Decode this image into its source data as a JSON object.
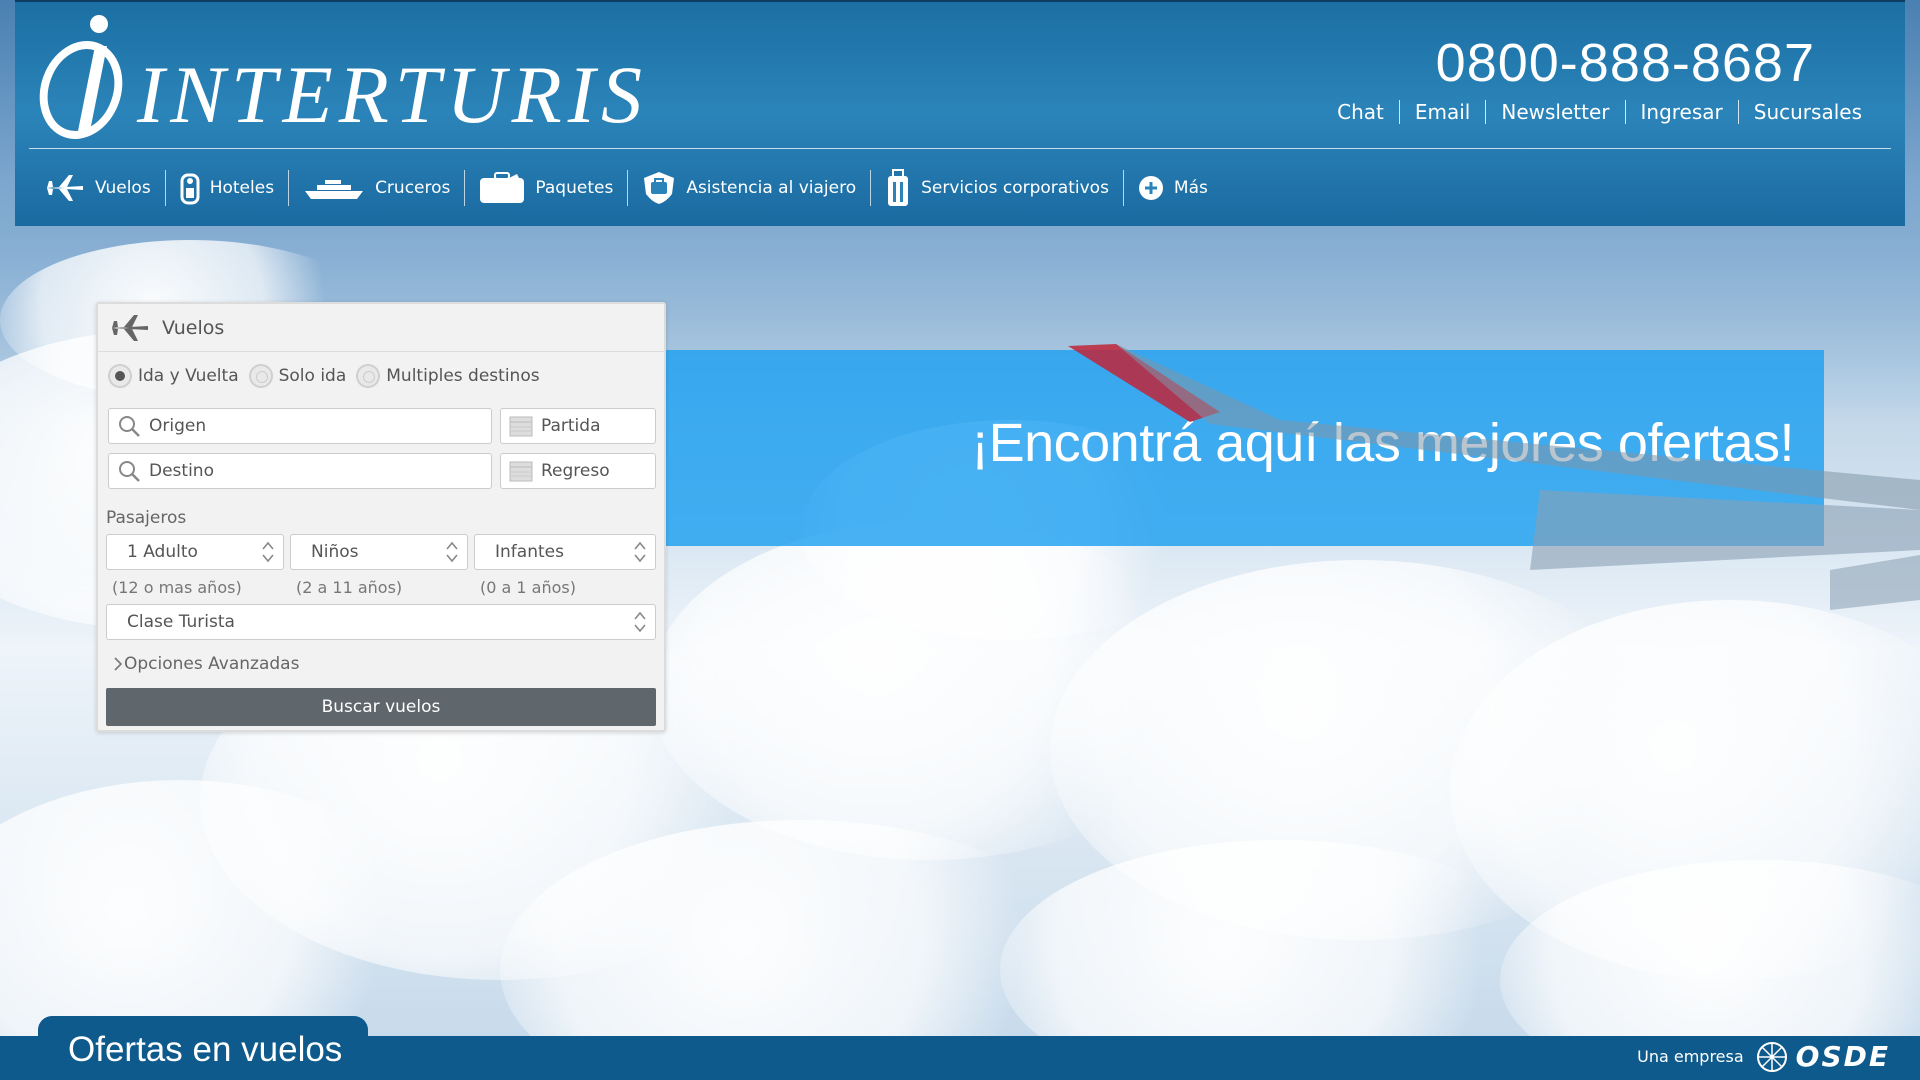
{
  "brand": {
    "name": "INTERTURIS",
    "logo_letter": "i"
  },
  "header": {
    "phone": "0800-888-8687",
    "links": [
      "Chat",
      "Email",
      "Newsletter",
      "Ingresar",
      "Sucursales"
    ]
  },
  "nav": {
    "items": [
      {
        "label": "Vuelos",
        "icon": "plane-icon"
      },
      {
        "label": "Hoteles",
        "icon": "hotel-tag-icon"
      },
      {
        "label": "Cruceros",
        "icon": "ship-icon"
      },
      {
        "label": "Paquetes",
        "icon": "suitcase-icon"
      },
      {
        "label": "Asistencia al viajero",
        "icon": "shield-icon"
      },
      {
        "label": "Servicios corporativos",
        "icon": "briefcase-tall-icon"
      },
      {
        "label": "Más",
        "icon": "plus-circle-icon"
      }
    ]
  },
  "search": {
    "title": "Vuelos",
    "trip_types": [
      {
        "label": "Ida y Vuelta",
        "selected": true
      },
      {
        "label": "Solo ida",
        "selected": false
      },
      {
        "label": "Multiples destinos",
        "selected": false
      }
    ],
    "origin_placeholder": "Origen",
    "destination_placeholder": "Destino",
    "departure_placeholder": "Partida",
    "return_placeholder": "Regreso",
    "passengers_label": "Pasajeros",
    "adults": {
      "value": "1 Adulto",
      "hint": "(12 o mas años)"
    },
    "children": {
      "value": "Niños",
      "hint": "(2 a 11 años)"
    },
    "infants": {
      "value": "Infantes",
      "hint": "(0 a 1 años)"
    },
    "class": "Clase Turista",
    "advanced": "Opciones Avanzadas",
    "submit": "Buscar vuelos"
  },
  "banner": {
    "text": "¡Encontrá aquí las mejores ofertas!"
  },
  "footer": {
    "tab": "Ofertas en vuelos",
    "company_prefix": "Una empresa",
    "company": "OSDE"
  },
  "colors": {
    "header_blue": "#1b6fa3",
    "footer_blue": "#0f5a8c",
    "banner_blue": "#1ea0f0",
    "button_gray": "#5f676d"
  }
}
